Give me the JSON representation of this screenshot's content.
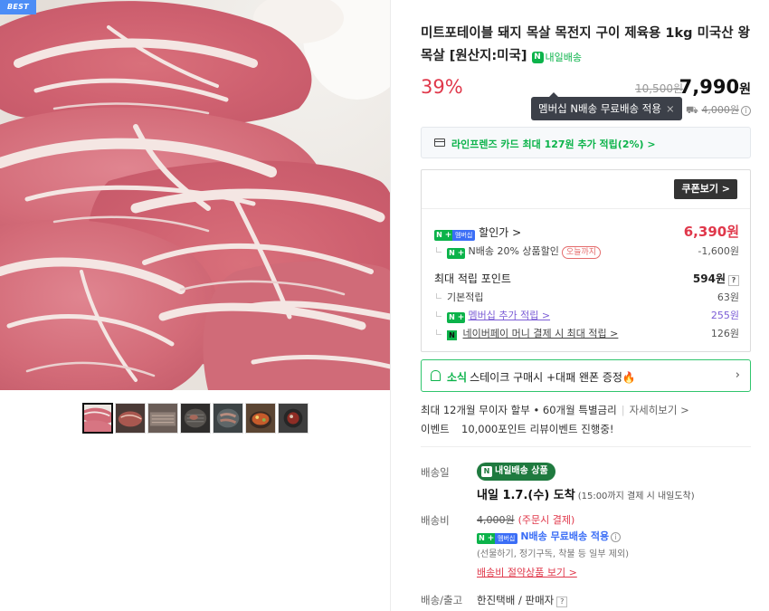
{
  "badge": {
    "best": "BEST"
  },
  "product": {
    "title": "미트포테이블 돼지 목살 목전지 구이 제육용 1kg 미국산 왕목살 [원산지:미국]",
    "nextday_label": "내일배송",
    "discount": "39%",
    "original_price": "10,500원",
    "sale_price": "7,990",
    "sale_currency": "원"
  },
  "tooltip": {
    "text": "멤버십 N배송 무료배송 적용",
    "close": "×"
  },
  "shipping_mini": {
    "fee": "4,000원"
  },
  "card_benefit": {
    "text": "라인프렌즈 카드 최대 127원 추가 적립(2%) >"
  },
  "coupon": {
    "button": "쿠폰보기 >",
    "badge_mem": "멤버십",
    "discount_label": "할인가 >",
    "discount_price": "6,390원",
    "sub_discount_label": "N배송 20% 상품할인",
    "today_tag": "오늘까지",
    "sub_discount_value": "-1,600원",
    "points_label": "최대 적립 포인트",
    "points_value": "594원",
    "q_mark": "?",
    "basic_label": "기본적립",
    "basic_value": "63원",
    "membership_label": "멤버십 추가 적립 >",
    "membership_value": "255원",
    "npay_label": "네이버페이 머니 결제 시 최대 적립 >",
    "npay_value": "126원"
  },
  "event": {
    "tag": "소식",
    "text": "스테이크 구매시 +대패 왠폰 증정🔥",
    "chevron": "›"
  },
  "installment": {
    "text": "최대 12개월 무이자 할부 • 60개월 특별금리",
    "link": "자세히보기 >"
  },
  "event_line": {
    "label": "이벤트",
    "text": "10,000포인트 리뷰이벤트 진행중!"
  },
  "delivery": {
    "date_label": "배송일",
    "nd_pill": "내일배송 상품",
    "nd_mark": "N",
    "arrival": "내일 1.7.(수) 도착",
    "arrival_note": "(15:00까지 결제 시 내일도착)",
    "fee_label": "배송비",
    "fee_original": "4,000원",
    "fee_note": "(주문시 결제)",
    "fee_member": "N배송 무료배송 적용",
    "fee_exclusion": "(선물하기, 정기구독, 착불 등 일부 제외)",
    "fee_saving_link": "배송비 절약상품 보기 >",
    "carrier_label": "배송/출고",
    "carrier_value": "한진택배 / 판매자"
  }
}
